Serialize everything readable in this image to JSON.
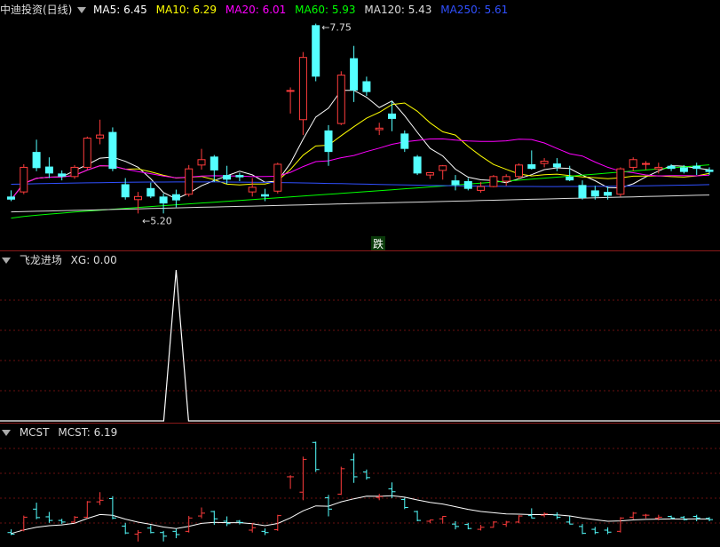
{
  "main_panel": {
    "stock_name": "中迪投资(日线)",
    "ma": [
      {
        "label": "MA5: 6.45",
        "color": "#ffffff"
      },
      {
        "label": "MA10: 6.29",
        "color": "#ffff00"
      },
      {
        "label": "MA20: 6.01",
        "color": "#ff00ff"
      },
      {
        "label": "MA60: 5.93",
        "color": "#00ff00"
      },
      {
        "label": "MA120: 5.43",
        "color": "#dddddd"
      },
      {
        "label": "MA250: 5.61",
        "color": "#3050ff"
      }
    ],
    "high_label": "7.75",
    "low_label": "5.20",
    "signal_label": "跌"
  },
  "panel2": {
    "title": "飞龙进场",
    "value_label": "XG: 0.00"
  },
  "panel3": {
    "title": "MCST",
    "value_label": "MCST: 6.19"
  },
  "colors": {
    "up": "#ff3c3c",
    "down": "#54ffff",
    "separator": "#8a1a1a"
  },
  "chart_data": {
    "type": "candlestick",
    "candles": [
      [
        5.52,
        5.6,
        5.46,
        5.48
      ],
      [
        5.58,
        5.94,
        5.55,
        5.9
      ],
      [
        6.1,
        6.26,
        5.85,
        5.89
      ],
      [
        5.91,
        6.03,
        5.76,
        5.82
      ],
      [
        5.82,
        5.86,
        5.73,
        5.78
      ],
      [
        5.78,
        5.93,
        5.75,
        5.9
      ],
      [
        5.9,
        6.3,
        5.87,
        6.28
      ],
      [
        6.28,
        6.52,
        6.2,
        6.32
      ],
      [
        6.36,
        6.42,
        5.85,
        5.88
      ],
      [
        5.68,
        5.76,
        5.48,
        5.51
      ],
      [
        5.48,
        5.58,
        5.3,
        5.52
      ],
      [
        5.63,
        5.7,
        5.5,
        5.52
      ],
      [
        5.52,
        5.56,
        5.3,
        5.43
      ],
      [
        5.55,
        5.61,
        5.38,
        5.47
      ],
      [
        5.55,
        5.93,
        5.52,
        5.88
      ],
      [
        5.93,
        6.14,
        5.87,
        6.0
      ],
      [
        6.04,
        6.06,
        5.71,
        5.86
      ],
      [
        5.8,
        5.92,
        5.68,
        5.74
      ],
      [
        5.8,
        5.83,
        5.72,
        5.77
      ],
      [
        5.58,
        5.76,
        5.52,
        5.64
      ],
      [
        5.55,
        5.62,
        5.46,
        5.52
      ],
      [
        5.59,
        5.96,
        5.56,
        5.94
      ],
      [
        6.9,
        6.94,
        6.6,
        6.9
      ],
      [
        6.52,
        7.4,
        6.32,
        7.33
      ],
      [
        7.75,
        7.77,
        7.02,
        7.08
      ],
      [
        6.38,
        6.45,
        5.92,
        6.1
      ],
      [
        6.47,
        7.15,
        6.45,
        7.1
      ],
      [
        7.32,
        7.48,
        6.75,
        6.9
      ],
      [
        7.02,
        7.08,
        6.83,
        6.88
      ],
      [
        6.39,
        6.48,
        6.32,
        6.41
      ],
      [
        6.6,
        6.76,
        6.37,
        6.53
      ],
      [
        6.34,
        6.38,
        6.1,
        6.14
      ],
      [
        6.04,
        6.06,
        5.8,
        5.82
      ],
      [
        5.8,
        5.84,
        5.75,
        5.83
      ],
      [
        5.86,
        5.93,
        5.74,
        5.92
      ],
      [
        5.73,
        5.8,
        5.6,
        5.67
      ],
      [
        5.72,
        5.76,
        5.6,
        5.62
      ],
      [
        5.6,
        5.71,
        5.57,
        5.65
      ],
      [
        5.65,
        5.8,
        5.64,
        5.78
      ],
      [
        5.72,
        5.81,
        5.66,
        5.78
      ],
      [
        5.78,
        5.95,
        5.75,
        5.93
      ],
      [
        5.94,
        6.12,
        5.87,
        5.88
      ],
      [
        5.95,
        6.02,
        5.9,
        5.98
      ],
      [
        5.95,
        6.02,
        5.85,
        5.9
      ],
      [
        5.78,
        5.92,
        5.72,
        5.73
      ],
      [
        5.67,
        5.73,
        5.48,
        5.5
      ],
      [
        5.6,
        5.66,
        5.48,
        5.52
      ],
      [
        5.58,
        5.65,
        5.48,
        5.53
      ],
      [
        5.55,
        5.9,
        5.52,
        5.88
      ],
      [
        5.9,
        6.03,
        5.85,
        6.0
      ],
      [
        5.95,
        5.98,
        5.87,
        5.95
      ],
      [
        5.88,
        5.96,
        5.82,
        5.9
      ],
      [
        5.92,
        5.94,
        5.85,
        5.88
      ],
      [
        5.9,
        5.93,
        5.82,
        5.84
      ],
      [
        5.92,
        5.96,
        5.8,
        5.88
      ],
      [
        5.87,
        5.9,
        5.8,
        5.84
      ]
    ],
    "panel2_series": {
      "name": "XG",
      "spike_index": 13,
      "spike_value": 1
    }
  }
}
